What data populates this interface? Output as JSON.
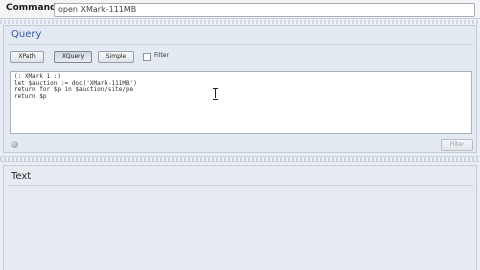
{
  "command": {
    "label": "Command",
    "value": "open XMark-111MB"
  },
  "query": {
    "title": "Query",
    "buttons": {
      "xpath": "XPath",
      "xquery": "XQuery",
      "simple": "Simple"
    },
    "filter_checkbox_label": "Filter",
    "code": "(: XMark 1 :)\nlet $auction := doc('XMark-111MB')\nreturn for $p in $auction/site/pe\nreturn $p",
    "filter_button": "Filter"
  },
  "text_panel": {
    "title": "Text"
  }
}
